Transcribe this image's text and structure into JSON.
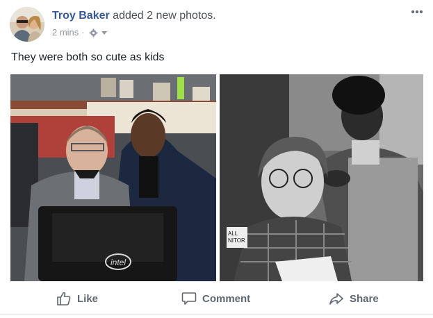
{
  "post": {
    "author": "Troy Baker",
    "action_text": " added 2 new photos.",
    "timestamp": "2 mins",
    "separator": "·",
    "privacy_icon": "gear-globe-icon",
    "menu_icon": "more-options-icon",
    "text": "They were both so cute as kids"
  },
  "photos": [
    {
      "alt_icon": "photo-thumbnail",
      "logo_text": "intel"
    },
    {
      "alt_icon": "photo-thumbnail",
      "sign_text_1": "ALL",
      "sign_text_2": "NITOR"
    }
  ],
  "actions": {
    "like_label": "Like",
    "comment_label": "Comment",
    "share_label": "Share"
  },
  "colors": {
    "author": "#365899",
    "meta": "#90949c",
    "action_text": "#606770"
  }
}
